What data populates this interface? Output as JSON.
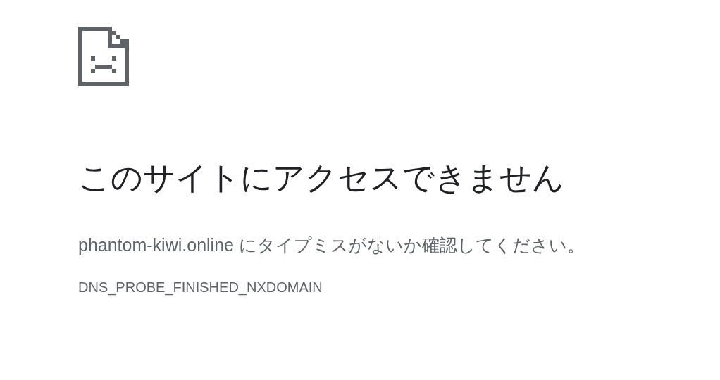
{
  "heading": "このサイトにアクセスできません",
  "message": "phantom-kiwi.online にタイプミスがないか確認してください。",
  "error_code": "DNS_PROBE_FINISHED_NXDOMAIN"
}
